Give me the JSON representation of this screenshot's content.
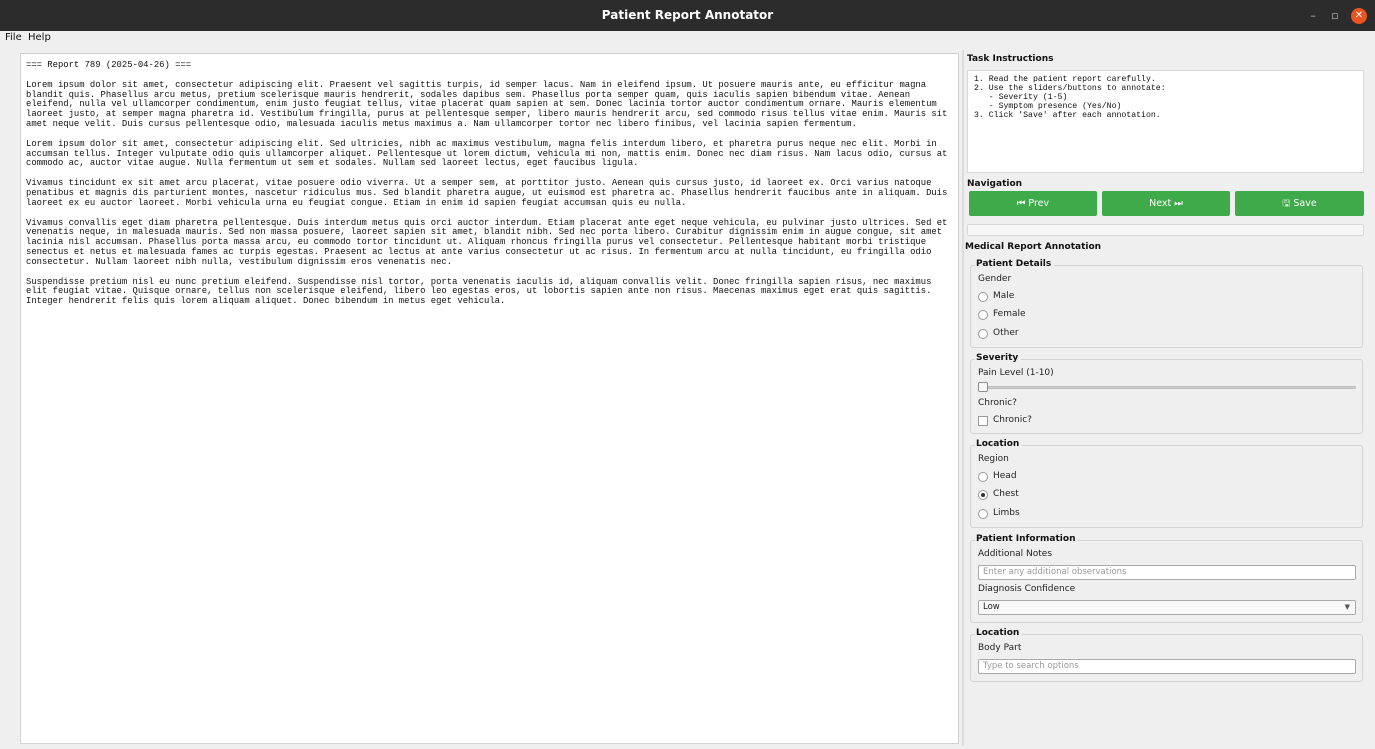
{
  "window": {
    "title": "Patient Report Annotator",
    "minimize": "–",
    "maximize": "▫",
    "close": "✕"
  },
  "menu": {
    "file": "File",
    "help": "Help"
  },
  "report": {
    "header": "=== Report 789 (2025-04-26) ===",
    "paragraphs": [
      "Lorem ipsum dolor sit amet, consectetur adipiscing elit. Praesent vel sagittis turpis, id semper lacus. Nam in eleifend ipsum. Ut posuere mauris ante, eu efficitur magna blandit quis. Phasellus arcu metus, pretium scelerisque mauris hendrerit, sodales dapibus sem. Phasellus porta semper quam, quis iaculis sapien bibendum vitae. Aenean eleifend, nulla vel ullamcorper condimentum, enim justo feugiat tellus, vitae placerat quam sapien at sem. Donec lacinia tortor auctor condimentum ornare. Mauris elementum laoreet justo, at semper magna pharetra id. Vestibulum fringilla, purus at pellentesque semper, libero mauris hendrerit arcu, sed commodo risus tellus vitae enim. Mauris sit amet neque velit. Duis cursus pellentesque odio, malesuada iaculis metus maximus a. Nam ullamcorper tortor nec libero finibus, vel lacinia sapien fermentum.",
      "Lorem ipsum dolor sit amet, consectetur adipiscing elit. Sed ultricies, nibh ac maximus vestibulum, magna felis interdum libero, et pharetra purus neque nec elit. Morbi in accumsan tellus. Integer vulputate odio quis ullamcorper aliquet. Pellentesque ut lorem dictum, vehicula mi non, mattis enim. Donec nec diam risus. Nam lacus odio, cursus at commodo ac, auctor vitae augue. Nulla fermentum ut sem et sodales. Nullam sed laoreet lectus, eget faucibus ligula.",
      "Vivamus tincidunt ex sit amet arcu placerat, vitae posuere odio viverra. Ut a semper sem, at porttitor justo. Aenean quis cursus justo, id laoreet ex. Orci varius natoque penatibus et magnis dis parturient montes, nascetur ridiculus mus. Sed blandit pharetra augue, ut euismod est pharetra ac. Phasellus hendrerit faucibus ante in aliquam. Duis laoreet ex eu auctor laoreet. Morbi vehicula urna eu feugiat congue. Etiam in enim id sapien feugiat accumsan quis eu nulla.",
      "Vivamus convallis eget diam pharetra pellentesque. Duis interdum metus quis orci auctor interdum. Etiam placerat ante eget neque vehicula, eu pulvinar justo ultrices. Sed et venenatis neque, in malesuada mauris. Sed non massa posuere, laoreet sapien sit amet, blandit nibh. Sed nec porta libero. Curabitur dignissim enim in augue congue, sit amet lacinia nisl accumsan. Phasellus porta massa arcu, eu commodo tortor tincidunt ut. Aliquam rhoncus fringilla purus vel consectetur. Pellentesque habitant morbi tristique senectus et netus et malesuada fames ac turpis egestas. Praesent ac lectus at ante varius consectetur ut ac risus. In fermentum arcu at nulla tincidunt, eu fringilla odio consectetur. Nullam laoreet nibh nulla, vestibulum dignissim eros venenatis nec.",
      "Suspendisse pretium nisl eu nunc pretium eleifend. Suspendisse nisl tortor, porta venenatis iaculis id, aliquam convallis velit. Donec fringilla sapien risus, nec maximus elit feugiat vitae. Quisque ornare, tellus non scelerisque eleifend, libero leo egestas eros, ut lobortis sapien ante non risus. Maecenas maximus eget erat quis sagittis. Integer hendrerit felis quis lorem aliquam aliquet. Donec bibendum in metus eget vehicula."
    ]
  },
  "instructions": {
    "title": "Task Instructions",
    "text": "1. Read the patient report carefully.\n2. Use the sliders/buttons to annotate:\n   - Severity (1-5)\n   - Symptom presence (Yes/No)\n3. Click 'Save' after each annotation."
  },
  "navigation": {
    "title": "Navigation",
    "prev": "⏮ Prev",
    "next": "Next ⏭",
    "save": "🖫 Save",
    "accent": "#3faa49"
  },
  "annotation": {
    "title": "Medical Report Annotation",
    "patient_details": {
      "title": "Patient Details",
      "gender_label": "Gender",
      "options": [
        "Male",
        "Female",
        "Other"
      ],
      "selected": null
    },
    "severity": {
      "title": "Severity",
      "pain_label": "Pain Level (1-10)",
      "pain_value": 1,
      "chronic_label": "Chronic?",
      "chronic_checkbox": "Chronic?",
      "chronic_checked": false
    },
    "location": {
      "title": "Location",
      "region_label": "Region",
      "options": [
        "Head",
        "Chest",
        "Limbs"
      ],
      "selected": "Chest"
    },
    "patient_information": {
      "title": "Patient Information",
      "notes_label": "Additional Notes",
      "notes_placeholder": "Enter any additional observations",
      "confidence_label": "Diagnosis Confidence",
      "confidence_value": "Low"
    },
    "location2": {
      "title": "Location",
      "body_part_label": "Body Part",
      "body_part_placeholder": "Type to search options"
    }
  }
}
